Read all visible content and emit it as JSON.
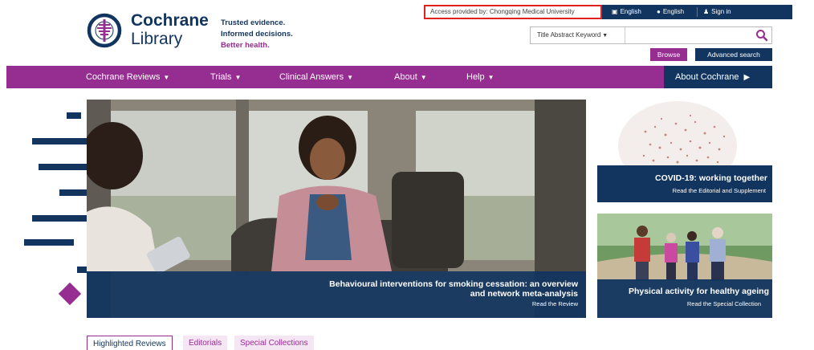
{
  "top_bar": {
    "access_text": "Access provided by: Chongqing Medical University",
    "language_1": "English",
    "language_2": "English",
    "sign_in": "Sign in"
  },
  "logo": {
    "title": "Cochrane",
    "subtitle": "Library",
    "tagline_1": "Trusted evidence.",
    "tagline_2": "Informed decisions.",
    "tagline_3": "Better health."
  },
  "search": {
    "scope_label": "Title Abstract Keyword",
    "query": "",
    "browse_label": "Browse",
    "advanced_label": "Advanced search"
  },
  "nav": {
    "items": [
      {
        "label": "Cochrane Reviews"
      },
      {
        "label": "Trials"
      },
      {
        "label": "Clinical Answers"
      },
      {
        "label": "About"
      },
      {
        "label": "Help"
      }
    ],
    "about_cochrane": "About Cochrane"
  },
  "hero": {
    "title": "Behavioural interventions for smoking cessation: an overview and network meta-analysis",
    "link": "Read the Review"
  },
  "cards": {
    "covid": {
      "title": "COVID-19: working together",
      "link": "Read the Editorial and Supplement"
    },
    "activity": {
      "title": "Physical activity for healthy ageing",
      "link": "Read the Special Collection"
    }
  },
  "tabs": [
    {
      "label": "Highlighted Reviews",
      "active": true
    },
    {
      "label": "Editorials",
      "active": false
    },
    {
      "label": "Special Collections",
      "active": false
    }
  ],
  "colors": {
    "navy": "#11355f",
    "purple": "#962d91",
    "access_highlight": "#e0221e"
  }
}
